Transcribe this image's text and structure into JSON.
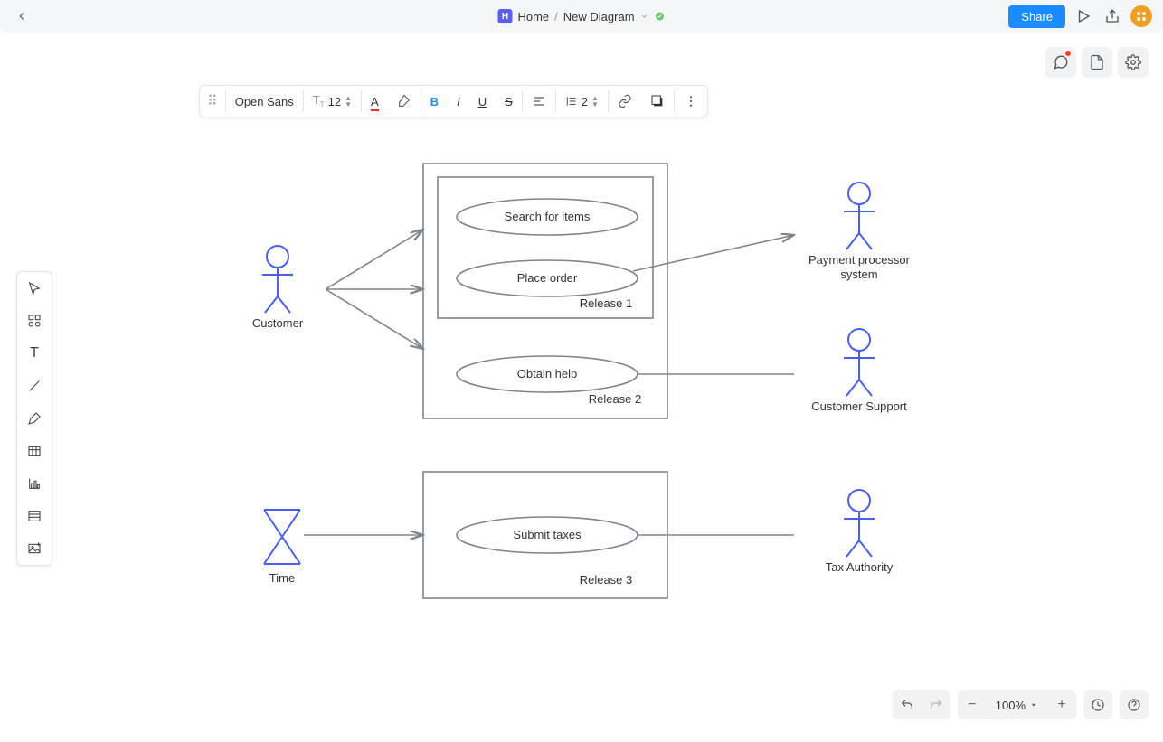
{
  "header": {
    "home_label": "Home",
    "separator": "/",
    "doc_name": "New Diagram",
    "share_label": "Share"
  },
  "text_toolbar": {
    "font_family": "Open Sans",
    "font_size": "12",
    "line_height": "2"
  },
  "zoom": {
    "value": "100%"
  },
  "diagram": {
    "actors": {
      "customer": "Customer",
      "payment": "Payment processor system",
      "support": "Customer Support",
      "time": "Time",
      "tax": "Tax Authority"
    },
    "releases": {
      "r1": "Release 1",
      "r2": "Release 2",
      "r3": "Release 3"
    },
    "usecases": {
      "search": "Search for items",
      "place": "Place order",
      "help": "Obtain help",
      "taxes": "Submit taxes"
    }
  },
  "chart_data": {
    "type": "use-case-diagram",
    "actors": [
      {
        "id": "customer",
        "label": "Customer",
        "kind": "person"
      },
      {
        "id": "payment",
        "label": "Payment processor system",
        "kind": "person"
      },
      {
        "id": "support",
        "label": "Customer Support",
        "kind": "person"
      },
      {
        "id": "time",
        "label": "Time",
        "kind": "hourglass"
      },
      {
        "id": "tax",
        "label": "Tax Authority",
        "kind": "person"
      }
    ],
    "boundaries": [
      {
        "id": "outer",
        "contains": [
          "r1",
          "r2"
        ]
      },
      {
        "id": "r1",
        "label": "Release 1",
        "usecases": [
          "search",
          "place"
        ]
      },
      {
        "id": "r2",
        "label": "Release 2",
        "usecases": [
          "help"
        ]
      },
      {
        "id": "r3",
        "label": "Release 3",
        "usecases": [
          "taxes"
        ]
      }
    ],
    "usecases": [
      {
        "id": "search",
        "label": "Search for items"
      },
      {
        "id": "place",
        "label": "Place order"
      },
      {
        "id": "help",
        "label": "Obtain help"
      },
      {
        "id": "taxes",
        "label": "Submit taxes"
      }
    ],
    "associations": [
      {
        "from": "customer",
        "to": "search"
      },
      {
        "from": "customer",
        "to": "place"
      },
      {
        "from": "customer",
        "to": "help"
      },
      {
        "from": "place",
        "to": "payment",
        "arrow": true
      },
      {
        "from": "help",
        "to": "support"
      },
      {
        "from": "time",
        "to": "taxes"
      },
      {
        "from": "taxes",
        "to": "tax"
      }
    ]
  }
}
